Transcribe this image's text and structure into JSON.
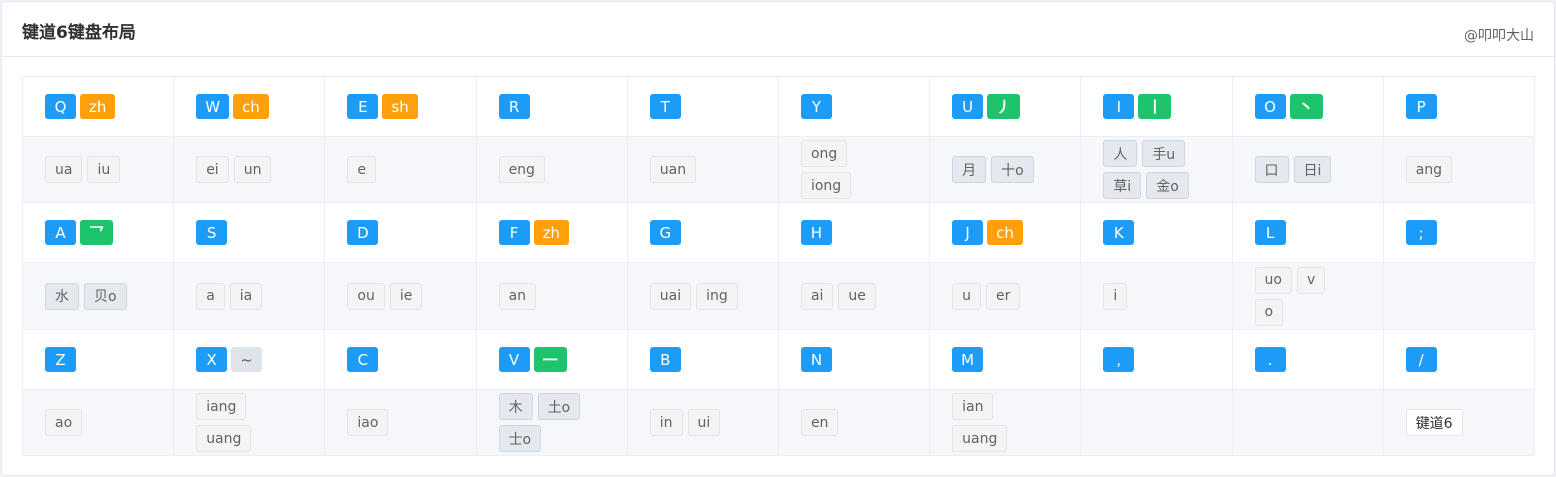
{
  "header": {
    "title": "键道6键盘布局",
    "author": "@叩叩大山"
  },
  "rows": [
    {
      "keys": [
        {
          "key": "Q",
          "ini": "zh"
        },
        {
          "key": "W",
          "ini": "ch"
        },
        {
          "key": "E",
          "ini": "sh"
        },
        {
          "key": "R"
        },
        {
          "key": "T"
        },
        {
          "key": "Y"
        },
        {
          "key": "U",
          "rad": "丿"
        },
        {
          "key": "I",
          "rad": "丨"
        },
        {
          "key": "O",
          "rad": "丶"
        },
        {
          "key": "P"
        }
      ],
      "vals": [
        [
          [
            "ua",
            "iu"
          ]
        ],
        [
          [
            "ei",
            "un"
          ]
        ],
        [
          [
            "e"
          ]
        ],
        [
          [
            "eng"
          ]
        ],
        [
          [
            "uan"
          ]
        ],
        [
          [
            "ong"
          ],
          [
            "iong"
          ]
        ],
        [
          [
            "月",
            "十o"
          ]
        ],
        [
          [
            "人",
            "手u"
          ],
          [
            "草i",
            "金o"
          ]
        ],
        [
          [
            "口",
            "日i"
          ]
        ],
        [
          [
            "ang"
          ]
        ]
      ]
    },
    {
      "keys": [
        {
          "key": "A",
          "rad": "乛"
        },
        {
          "key": "S"
        },
        {
          "key": "D"
        },
        {
          "key": "F",
          "ini": "zh"
        },
        {
          "key": "G"
        },
        {
          "key": "H"
        },
        {
          "key": "J",
          "ini": "ch"
        },
        {
          "key": "K"
        },
        {
          "key": "L"
        },
        {
          "key": ";"
        }
      ],
      "vals": [
        [
          [
            "水",
            "贝o"
          ]
        ],
        [
          [
            "a",
            "ia"
          ]
        ],
        [
          [
            "ou",
            "ie"
          ]
        ],
        [
          [
            "an"
          ]
        ],
        [
          [
            "uai",
            "ing"
          ]
        ],
        [
          [
            "ai",
            "ue"
          ]
        ],
        [
          [
            "u",
            "er"
          ]
        ],
        [
          [
            "i"
          ]
        ],
        [
          [
            "uo",
            "v"
          ],
          [
            "o"
          ]
        ],
        []
      ]
    },
    {
      "keys": [
        {
          "key": "Z"
        },
        {
          "key": "X",
          "gray": "~"
        },
        {
          "key": "C"
        },
        {
          "key": "V",
          "rad": "一"
        },
        {
          "key": "B"
        },
        {
          "key": "N"
        },
        {
          "key": "M"
        },
        {
          "key": ","
        },
        {
          "key": "."
        },
        {
          "key": "/"
        }
      ],
      "vals": [
        [
          [
            "ao"
          ]
        ],
        [
          [
            "iang"
          ],
          [
            "uang"
          ]
        ],
        [
          [
            "iao"
          ]
        ],
        [
          [
            "木",
            "土o"
          ],
          [
            "士o"
          ]
        ],
        [
          [
            "in",
            "ui"
          ]
        ],
        [
          [
            "en"
          ]
        ],
        [
          [
            "ian"
          ],
          [
            "uang"
          ]
        ],
        [],
        [],
        [
          [
            "键道6"
          ]
        ]
      ]
    }
  ],
  "radical_values": [
    "月",
    "十o",
    "人",
    "手u",
    "草i",
    "金o",
    "口",
    "日i",
    "水",
    "贝o",
    "木",
    "土o",
    "士o"
  ],
  "plain_values": [
    "键道6"
  ],
  "colors": {
    "key": "#1c9cf6",
    "initial": "#ff9f0a",
    "radical": "#1ec46b",
    "symbol": "#dfe3ea"
  }
}
